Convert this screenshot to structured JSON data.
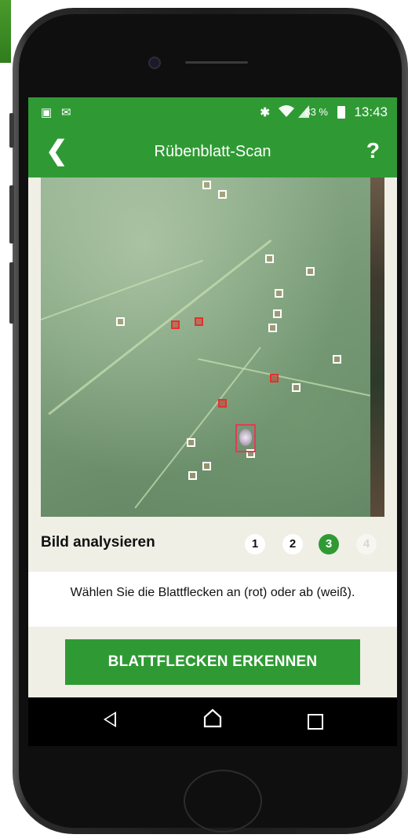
{
  "status_bar": {
    "battery_percent": "83 %",
    "time": "13:43",
    "icons": [
      "image-icon",
      "mail-icon",
      "bluetooth-icon",
      "wifi-icon",
      "signal-icon",
      "battery-icon"
    ]
  },
  "app_bar": {
    "title": "Rübenblatt-Scan",
    "back_icon": "chevron-left-icon",
    "help_label": "?"
  },
  "steps": {
    "title": "Bild analysieren",
    "items": [
      {
        "label": "1",
        "state": "done"
      },
      {
        "label": "2",
        "state": "done"
      },
      {
        "label": "3",
        "state": "active"
      },
      {
        "label": "4",
        "state": "todo"
      }
    ]
  },
  "instruction": "Wählen Sie die Blattflecken an (rot) oder ab (weiß).",
  "action_button": "BLATTFLECKEN ERKENNEN",
  "nav": {
    "back_icon": "triangle-back-icon",
    "home_icon": "home-icon",
    "recent_icon": "square-recent-icon"
  },
  "colors": {
    "brand_green": "#2f9a34",
    "selected_spot": "#e8302b",
    "deselected_spot": "#ffffff"
  }
}
